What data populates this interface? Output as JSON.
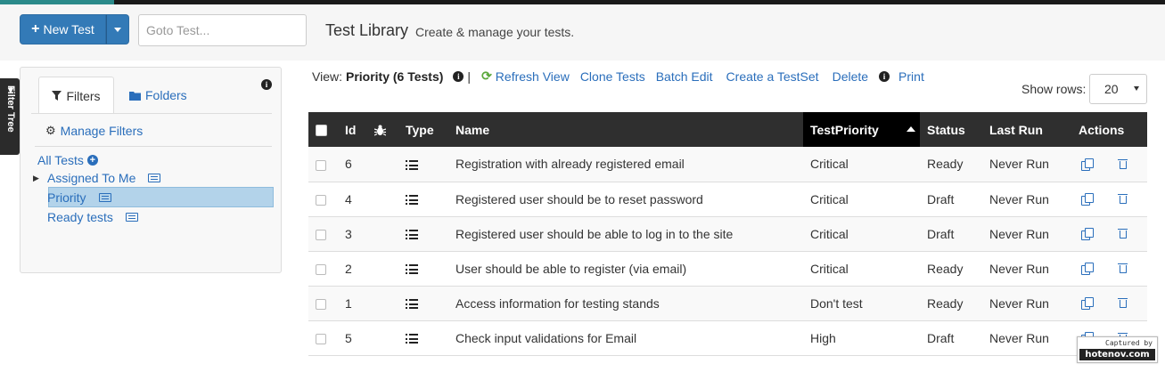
{
  "header": {
    "new_test_label": "New Test",
    "goto_placeholder": "Goto Test...",
    "title": "Test Library",
    "subtitle": "Create & manage your tests."
  },
  "filter_tree_tab": "Filter Tree",
  "panel": {
    "tabs": [
      {
        "label": "Filters",
        "icon": "filter-icon",
        "active": true
      },
      {
        "label": "Folders",
        "icon": "folder-icon",
        "active": false
      }
    ],
    "manage_filters": "Manage Filters",
    "tree": {
      "all_tests": "All Tests",
      "items": [
        {
          "label": "Assigned To Me",
          "expandable": true,
          "selected": false
        },
        {
          "label": "Priority",
          "expandable": false,
          "selected": true
        },
        {
          "label": "Ready tests",
          "expandable": false,
          "selected": false
        }
      ]
    }
  },
  "view_bar": {
    "view_label": "View:",
    "view_name": "Priority (6 Tests)",
    "separator": "|",
    "actions": {
      "refresh": "Refresh View",
      "clone": "Clone Tests",
      "batch_edit": "Batch Edit",
      "create_testset": "Create a TestSet",
      "delete": "Delete",
      "print": "Print"
    }
  },
  "show_rows": {
    "label": "Show rows:",
    "value": "20"
  },
  "table": {
    "columns": {
      "id": "Id",
      "type": "Type",
      "name": "Name",
      "priority": "TestPriority",
      "status": "Status",
      "last_run": "Last Run",
      "actions": "Actions"
    },
    "sorted_column": "TestPriority",
    "sort_direction": "ascending",
    "rows": [
      {
        "id": "6",
        "name": "Registration with already registered email",
        "priority": "Critical",
        "status": "Ready",
        "last_run": "Never Run"
      },
      {
        "id": "4",
        "name": "Registered user should be to reset password",
        "priority": "Critical",
        "status": "Draft",
        "last_run": "Never Run"
      },
      {
        "id": "3",
        "name": "Registered user should be able to log in to the site",
        "priority": "Critical",
        "status": "Draft",
        "last_run": "Never Run"
      },
      {
        "id": "2",
        "name": "User should be able to register (via email)",
        "priority": "Critical",
        "status": "Ready",
        "last_run": "Never Run"
      },
      {
        "id": "1",
        "name": "Access information for testing stands",
        "priority": "Don't test",
        "status": "Ready",
        "last_run": "Never Run"
      },
      {
        "id": "5",
        "name": "Check input validations for Email",
        "priority": "High",
        "status": "Draft",
        "last_run": "Never Run"
      }
    ]
  },
  "watermark": {
    "top": "Captured by",
    "bottom": "hotenov.com"
  },
  "colors": {
    "primary": "#337ab7",
    "link": "#2a6ebb",
    "header_dark": "#2f2f2f",
    "selected_row": "#b3d3ea",
    "refresh_green": "#5aa83a"
  }
}
